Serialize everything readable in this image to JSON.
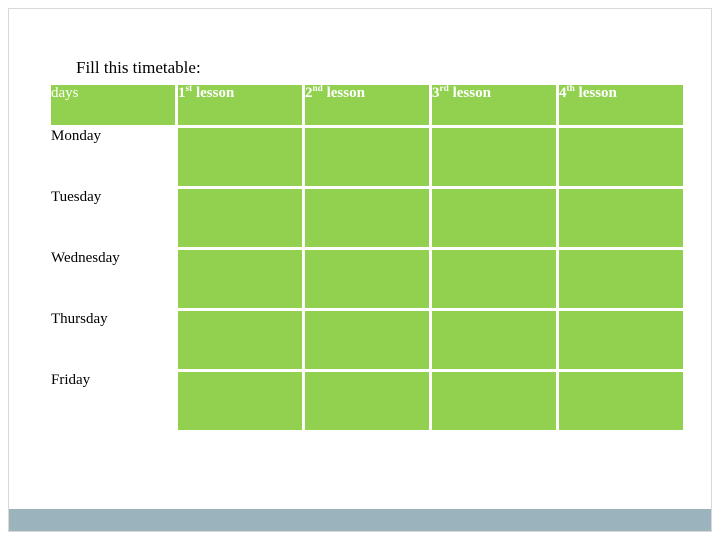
{
  "slide": {
    "prompt": "Fill this timetable:",
    "accent_color": "#92d050",
    "bottom_bar_color": "#9ab3bd",
    "header_text_color": "#ffffff"
  },
  "table": {
    "headers": [
      {
        "label": "days",
        "sup": ""
      },
      {
        "label": "1",
        "sup": "st",
        "suffix": " lesson"
      },
      {
        "label": "2",
        "sup": "nd",
        "suffix": " lesson"
      },
      {
        "label": "3",
        "sup": "rd",
        "suffix": " lesson"
      },
      {
        "label": "4",
        "sup": "th",
        "suffix": " lesson"
      }
    ],
    "rows": [
      {
        "day": "Monday",
        "lessons": [
          "",
          "",
          "",
          ""
        ]
      },
      {
        "day": "Tuesday",
        "lessons": [
          "",
          "",
          "",
          ""
        ]
      },
      {
        "day": "Wednesday",
        "lessons": [
          "",
          "",
          "",
          ""
        ]
      },
      {
        "day": "Thursday",
        "lessons": [
          "",
          "",
          "",
          ""
        ]
      },
      {
        "day": "Friday",
        "lessons": [
          "",
          "",
          "",
          ""
        ]
      }
    ]
  }
}
